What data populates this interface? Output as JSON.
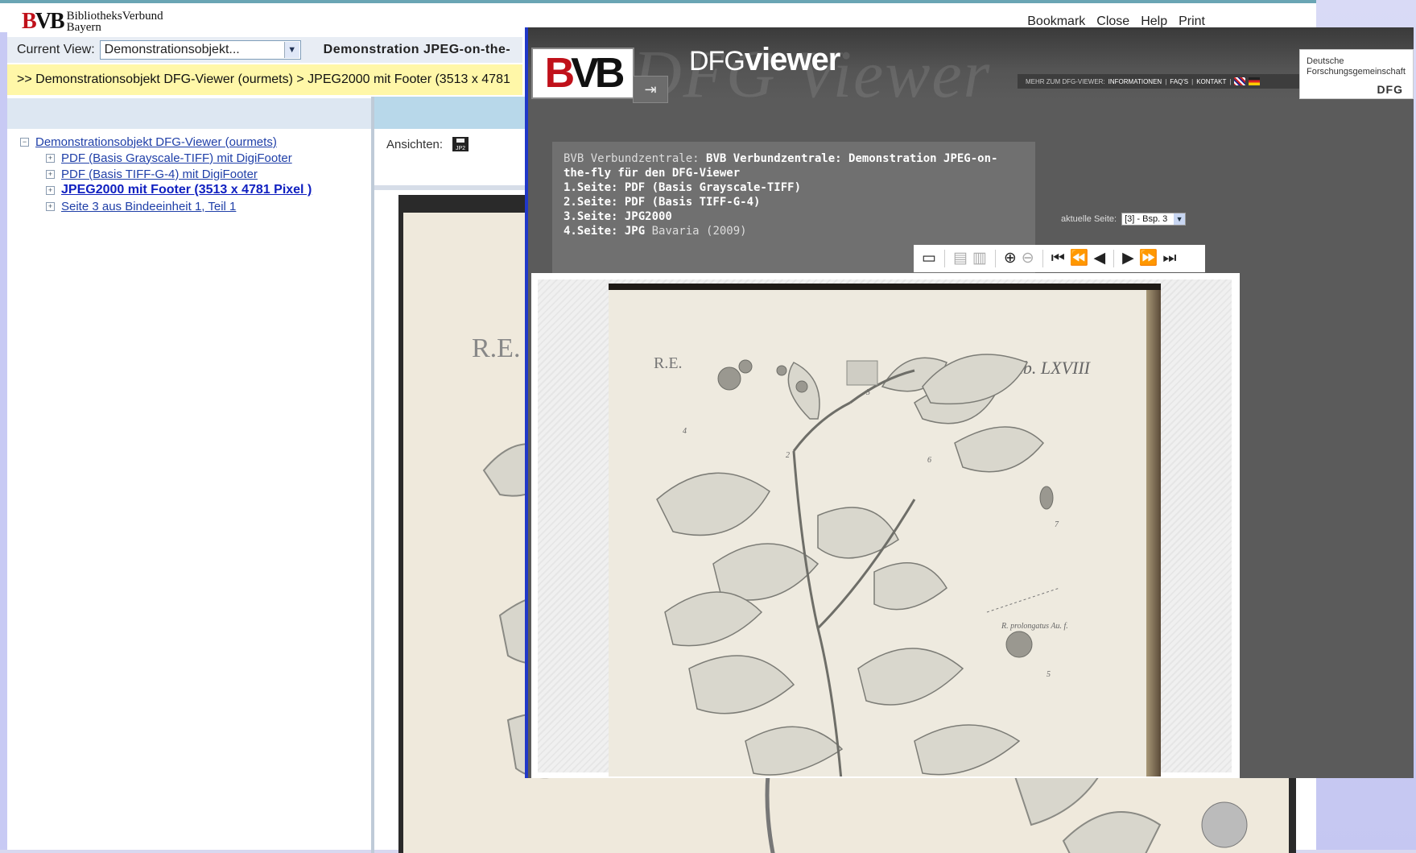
{
  "bg": {
    "logo": {
      "mark": "BVB",
      "line1": "BibliotheksVerbund",
      "line2": "Bayern"
    },
    "top_links": [
      "Bookmark",
      "Close",
      "Help",
      "Print"
    ],
    "current_view_label": "Current View:",
    "current_view_value": "Demonstrationsobjekt...",
    "view_title": "Demonstration JPEG-on-the-",
    "breadcrumb": ">> Demonstrationsobjekt DFG-Viewer (ourmets) > JPEG2000 mit Footer (3513 x 4781",
    "tree": {
      "root": "Demonstrationsobjekt DFG-Viewer (ourmets)",
      "children": [
        "PDF (Basis Grayscale-TIFF) mit DigiFooter",
        "PDF (Basis TIFF-G-4) mit DigiFooter",
        "JPEG2000 mit Footer (3513 x 4781 Pixel )",
        "Seite 3 aus Bindeeinheit 1, Teil 1"
      ]
    },
    "ansichten_label": "Ansichten:",
    "jp2_icon_text": "JP2",
    "image_re_text": "R.E."
  },
  "dfg": {
    "ghost_text": "DFG Viewer",
    "logo_mark": "BVB",
    "brand_thin": "DFG",
    "brand_bold": "viewer",
    "nav": {
      "prefix": "MEHR ZUM DFG-VIEWER:",
      "items": [
        "INFORMATIONEN",
        "FAQ'S",
        "KONTAKT"
      ]
    },
    "dfg_logo": {
      "line1": "Deutsche",
      "line2": "Forschungsgemeinschaft",
      "abbr": "DFG"
    },
    "meta": {
      "prefix": "BVB Verbundzentrale:",
      "title": "BVB Verbundzentrale: Demonstration JPEG-on-the-fly für den DFG-Viewer",
      "line1": "1.Seite: PDF (Basis Grayscale-TIFF)",
      "line2": "2.Seite: PDF (Basis TIFF-G-4)",
      "line3": "3.Seite: JPG2000",
      "line4_bold": "4.Seite: JPG",
      "line4_rest": "Bavaria (2009)"
    },
    "page_label": "aktuelle Seite:",
    "page_value": "[3] - Bsp. 3",
    "toolbar_icons": [
      "single-page-icon",
      "double-page-back-icon",
      "double-page-forward-icon",
      "zoom-in-icon",
      "zoom-out-icon",
      "first-page-icon",
      "back-ten-icon",
      "previous-page-icon",
      "next-page-icon",
      "forward-ten-icon",
      "last-page-icon"
    ],
    "scan": {
      "re": "R.E.",
      "tab": "Tab. LXVIII",
      "num2": "2",
      "num3": "3",
      "num4": "4",
      "num5": "5",
      "num6": "6",
      "num7": "7",
      "caption": "R. prolongatus Au. f."
    }
  },
  "colors": {
    "blue_border": "#2038c8",
    "breadcrumb_bg": "#fff7a8",
    "link": "#1f3fa8",
    "viewer_bg": "#5b5b5b"
  }
}
